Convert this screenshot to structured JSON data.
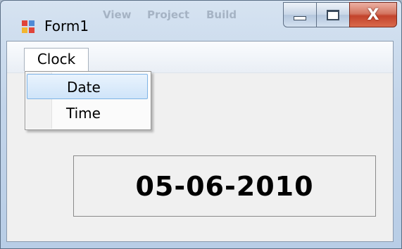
{
  "window": {
    "title": "Form1",
    "ghost_menu": [
      "View",
      "Project",
      "Build"
    ]
  },
  "titlebar_buttons": {
    "minimize": "minimize-icon",
    "maximize": "maximize-icon",
    "close": "close-icon",
    "close_glyph": "X"
  },
  "menu": {
    "top_item": "Clock",
    "dropdown": [
      {
        "label": "Date",
        "highlighted": true
      },
      {
        "label": "Time",
        "highlighted": false
      }
    ]
  },
  "display": {
    "value": "05-06-2010"
  },
  "colors": {
    "close_red": "#c3432b",
    "highlight_border": "#7fb4e6",
    "highlight_fill": "#cfe4f9"
  }
}
